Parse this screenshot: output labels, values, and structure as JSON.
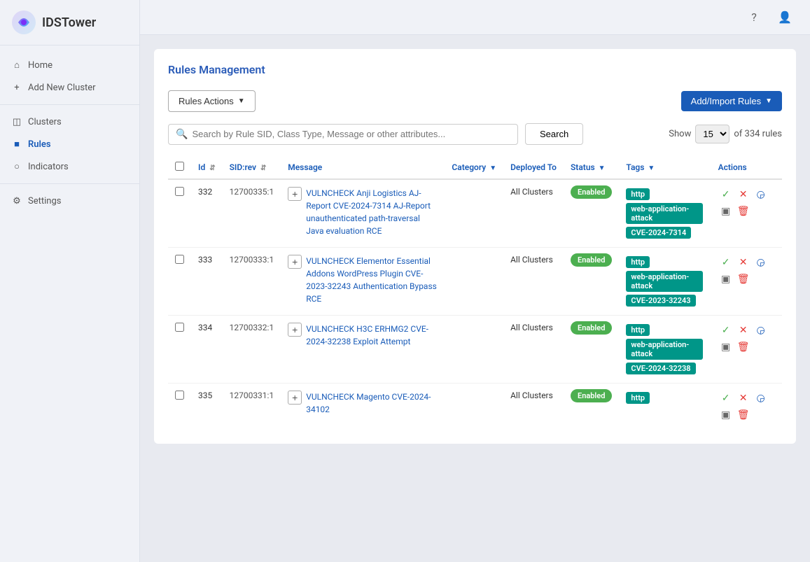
{
  "app": {
    "name": "IDSTower"
  },
  "sidebar": {
    "home_label": "Home",
    "add_cluster_label": "Add New Cluster",
    "clusters_label": "Clusters",
    "rules_label": "Rules",
    "indicators_label": "Indicators",
    "settings_label": "Settings"
  },
  "page": {
    "title": "Rules Management"
  },
  "toolbar": {
    "rules_actions_label": "Rules Actions",
    "add_import_label": "Add/Import Rules"
  },
  "search": {
    "placeholder": "Search by Rule SID, Class Type, Message or other attributes...",
    "button_label": "Search",
    "show_label": "Show",
    "show_value": "15",
    "total_label": "of 334 rules"
  },
  "table": {
    "columns": [
      "",
      "Id",
      "SID:rev",
      "Message",
      "Category",
      "Deployed To",
      "Status",
      "Tags",
      "Actions"
    ],
    "rows": [
      {
        "id": "332",
        "sid": "12700335:1",
        "message": "VULNCHECK Anji Logistics AJ-Report CVE-2024-7314 AJ-Report unauthenticated path-traversal Java evaluation RCE",
        "category_icon": "+",
        "deployed_to": "All Clusters",
        "status": "Enabled",
        "tags": [
          "http",
          "web-application-attack",
          "CVE-2024-7314"
        ]
      },
      {
        "id": "333",
        "sid": "12700333:1",
        "message": "VULNCHECK Elementor Essential Addons WordPress Plugin CVE-2023-32243 Authentication Bypass RCE",
        "category_icon": "+",
        "deployed_to": "All Clusters",
        "status": "Enabled",
        "tags": [
          "http",
          "web-application-attack",
          "CVE-2023-32243"
        ]
      },
      {
        "id": "334",
        "sid": "12700332:1",
        "message": "VULNCHECK H3C ERHMG2 CVE-2024-32238 Exploit Attempt",
        "category_icon": "+",
        "deployed_to": "All Clusters",
        "status": "Enabled",
        "tags": [
          "http",
          "web-application-attack",
          "CVE-2024-32238"
        ]
      },
      {
        "id": "335",
        "sid": "12700331:1",
        "message": "VULNCHECK Magento CVE-2024-34102",
        "category_icon": "+",
        "deployed_to": "All Clusters",
        "status": "Enabled",
        "tags": [
          "http"
        ]
      }
    ]
  }
}
